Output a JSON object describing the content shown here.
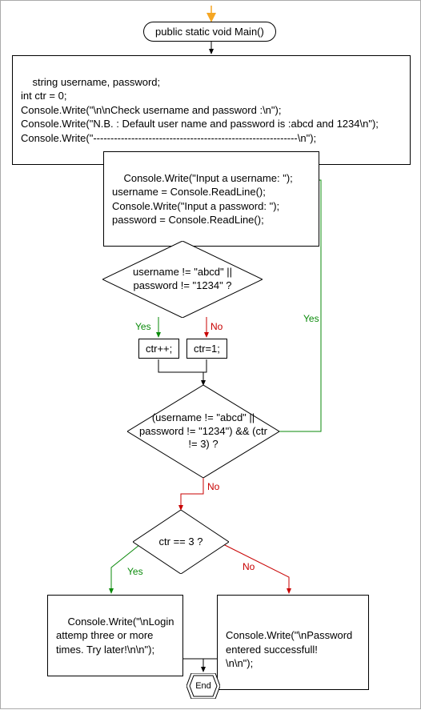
{
  "start_arrow_color": "#f5a623",
  "nodes": {
    "start": "public static void Main()",
    "init_block": "string username, password;\nint ctr = 0;\nConsole.Write(\"\\n\\nCheck username and password :\\n\");\nConsole.Write(\"N.B. : Default user name and password is :abcd and 1234\\n\");\nConsole.Write(\"-----------------------------------------------------------\\n\");",
    "input_block": "Console.Write(\"Input a username: \");\nusername = Console.ReadLine();\nConsole.Write(\"Input a password: \");\npassword = Console.ReadLine();",
    "decision1": "username != \"abcd\" ||\npassword != \"1234\" ?",
    "branch_yes": "ctr++;",
    "branch_no": "ctr=1;",
    "decision2": "(username != \"abcd\" ||\npassword != \"1234\")\n&& (ctr != 3) ?",
    "decision3": "ctr == 3 ?",
    "result_yes": "Console.Write(\"\\nLogin\nattemp three or more\ntimes. Try later!\\n\\n\");",
    "result_no": "Console.Write(\"\\nPassword\nentered successfull!\n\\n\\n\");",
    "end": "End"
  },
  "labels": {
    "yes": "Yes",
    "no": "No"
  },
  "chart_data": {
    "type": "flowchart",
    "title": "",
    "nodes": [
      {
        "id": "start",
        "type": "terminator",
        "text": "public static void Main()"
      },
      {
        "id": "init",
        "type": "process",
        "text": "string username, password; int ctr = 0; Console.Write(\"\\n\\nCheck username and password :\\n\"); Console.Write(\"N.B. : Default user name and password is :abcd and 1234\\n\"); Console.Write(\"-----------------------------------------------------------\\n\");"
      },
      {
        "id": "input",
        "type": "process",
        "text": "Console.Write(\"Input a username: \"); username = Console.ReadLine(); Console.Write(\"Input a password: \"); password = Console.ReadLine();"
      },
      {
        "id": "d1",
        "type": "decision",
        "text": "username != \"abcd\" || password != \"1234\" ?"
      },
      {
        "id": "byes",
        "type": "process",
        "text": "ctr++;"
      },
      {
        "id": "bno",
        "type": "process",
        "text": "ctr=1;"
      },
      {
        "id": "d2",
        "type": "decision",
        "text": "(username != \"abcd\" || password != \"1234\") && (ctr != 3) ?"
      },
      {
        "id": "d3",
        "type": "decision",
        "text": "ctr == 3 ?"
      },
      {
        "id": "ryes",
        "type": "process",
        "text": "Console.Write(\"\\nLogin attemp three or more times. Try later!\\n\\n\");"
      },
      {
        "id": "rno",
        "type": "process",
        "text": "Console.Write(\"\\nPassword entered successfull!\\n\\n\");"
      },
      {
        "id": "end",
        "type": "terminator",
        "text": "End"
      }
    ],
    "edges": [
      {
        "from": "start",
        "to": "init",
        "label": ""
      },
      {
        "from": "init",
        "to": "input",
        "label": ""
      },
      {
        "from": "input",
        "to": "d1",
        "label": ""
      },
      {
        "from": "d1",
        "to": "byes",
        "label": "Yes"
      },
      {
        "from": "d1",
        "to": "bno",
        "label": "No"
      },
      {
        "from": "byes",
        "to": "d2",
        "label": ""
      },
      {
        "from": "bno",
        "to": "d2",
        "label": ""
      },
      {
        "from": "d2",
        "to": "input",
        "label": "Yes"
      },
      {
        "from": "d2",
        "to": "d3",
        "label": "No"
      },
      {
        "from": "d3",
        "to": "ryes",
        "label": "Yes"
      },
      {
        "from": "d3",
        "to": "rno",
        "label": "No"
      },
      {
        "from": "ryes",
        "to": "end",
        "label": ""
      },
      {
        "from": "rno",
        "to": "end",
        "label": ""
      }
    ]
  }
}
